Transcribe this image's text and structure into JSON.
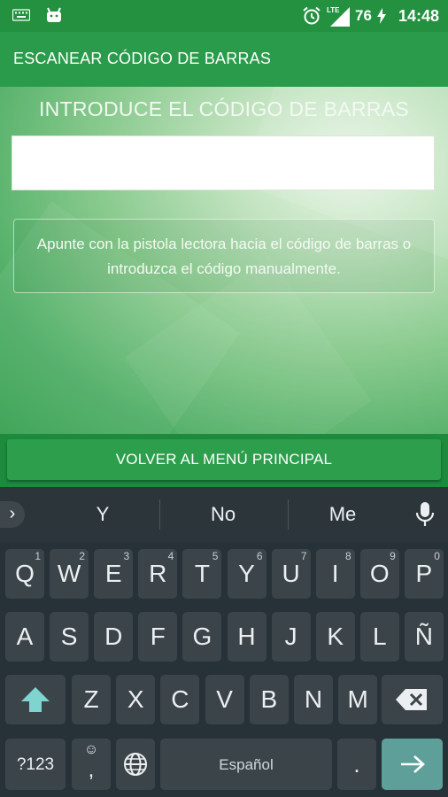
{
  "status": {
    "time": "14:48",
    "battery": "76",
    "network": "LTE"
  },
  "app": {
    "title": "ESCANEAR CÓDIGO DE BARRAS"
  },
  "content": {
    "heading": "INTRODUCE EL CÓDIGO DE BARRAS",
    "barcode_value": "",
    "info_text": "Apunte con la pistola lectora hacia el código de barras o introduzca el código manualmente.",
    "button_label": "VOLVER AL MENÚ PRINCIPAL"
  },
  "keyboard": {
    "suggestions": [
      "Y",
      "No",
      "Me"
    ],
    "row1": [
      {
        "k": "Q",
        "n": "1"
      },
      {
        "k": "W",
        "n": "2"
      },
      {
        "k": "E",
        "n": "3"
      },
      {
        "k": "R",
        "n": "4"
      },
      {
        "k": "T",
        "n": "5"
      },
      {
        "k": "Y",
        "n": "6"
      },
      {
        "k": "U",
        "n": "7"
      },
      {
        "k": "I",
        "n": "8"
      },
      {
        "k": "O",
        "n": "9"
      },
      {
        "k": "P",
        "n": "0"
      }
    ],
    "row2": [
      "A",
      "S",
      "D",
      "F",
      "G",
      "H",
      "J",
      "K",
      "L",
      "Ñ"
    ],
    "row3": [
      "Z",
      "X",
      "C",
      "V",
      "B",
      "N",
      "M"
    ],
    "symbols_label": "?123",
    "emoji_label": "☺",
    "comma_label": ",",
    "space_label": "Español",
    "period_label": "."
  },
  "colors": {
    "status_bar": "#23913f",
    "app_bar": "#2a9b4a",
    "keyboard_bg": "#263238",
    "enter_key": "#5e9f9a"
  }
}
